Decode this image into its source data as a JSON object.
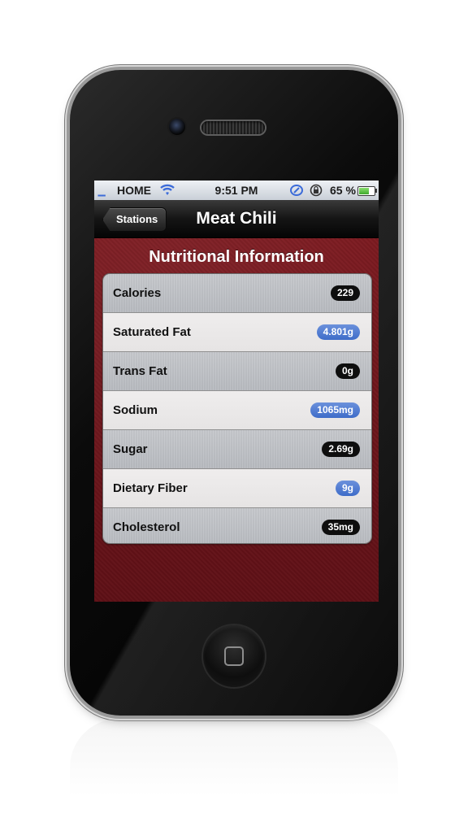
{
  "status_bar": {
    "carrier": "HOME",
    "time": "9:51 PM",
    "battery_percent": "65 %",
    "battery_level": 0.65,
    "icons": [
      "signal-bars-icon",
      "wifi-icon",
      "sync-icon",
      "orientation-lock-icon",
      "battery-icon"
    ]
  },
  "nav_bar": {
    "back_label": "Stations",
    "title": "Meat Chili"
  },
  "section_title": "Nutritional Information",
  "nutrition_rows": [
    {
      "label": "Calories",
      "value": "229",
      "badge_color": "#0e0e0e"
    },
    {
      "label": "Saturated Fat",
      "value": "4.801g",
      "badge_color": "#4a78d2"
    },
    {
      "label": "Trans Fat",
      "value": "0g",
      "badge_color": "#0e0e0e"
    },
    {
      "label": "Sodium",
      "value": "1065mg",
      "badge_color": "#4a78d2"
    },
    {
      "label": "Sugar",
      "value": "2.69g",
      "badge_color": "#0e0e0e"
    },
    {
      "label": "Dietary Fiber",
      "value": "9g",
      "badge_color": "#4a78d2"
    },
    {
      "label": "Cholesterol",
      "value": "35mg",
      "badge_color": "#0e0e0e"
    }
  ],
  "colors": {
    "background_red": "#6e141b",
    "accent_blue": "#4a78d2"
  }
}
